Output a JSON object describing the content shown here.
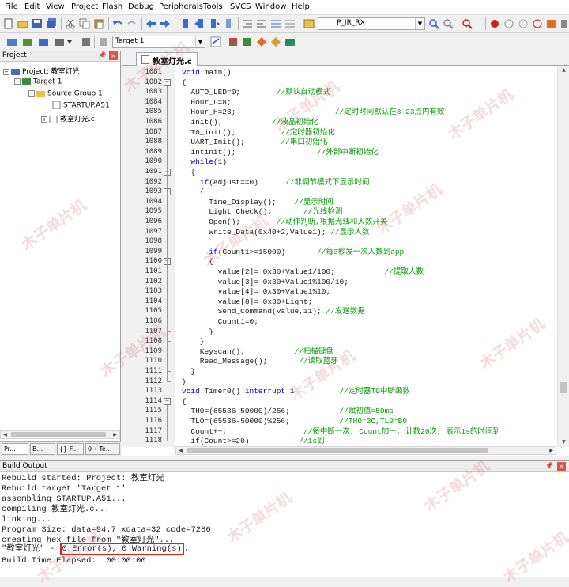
{
  "menu": [
    "File",
    "Edit",
    "View",
    "Project",
    "Flash",
    "Debug",
    "Peripherals",
    "Tools",
    "SVCS",
    "Window",
    "Help"
  ],
  "toolbar1": {
    "target_search": "P_IR_RX"
  },
  "toolbar2": {
    "target_select": "Target 1"
  },
  "project_panel": {
    "title": "Project",
    "tree": [
      {
        "label": "Project: 教室灯光",
        "icon": "project-icon"
      },
      {
        "label": "Target 1",
        "icon": "target-icon"
      },
      {
        "label": "Source Group 1",
        "icon": "folder-icon"
      },
      {
        "label": "STARTUP.A51",
        "icon": "asm-file-icon"
      },
      {
        "label": "教室灯光.c",
        "icon": "c-file-icon"
      }
    ],
    "tabs": [
      "Pr...",
      "B...",
      "{} F...",
      "0→ Te..."
    ]
  },
  "editor": {
    "tab_label": "教室灯光.c",
    "lines": [
      {
        "n": 1081,
        "code": "void main()"
      },
      {
        "n": 1082,
        "code": "{"
      },
      {
        "n": 1083,
        "code": "  AUTO_LED=0;        //默认自动模式"
      },
      {
        "n": 1084,
        "code": "  Hour_L=8;"
      },
      {
        "n": 1085,
        "code": "  Hour_H=23;                      //定时时间默认在8-23点内有效"
      },
      {
        "n": 1086,
        "code": "  init();           //液晶初始化"
      },
      {
        "n": 1087,
        "code": "  T0_init();          //定时器初始化"
      },
      {
        "n": 1088,
        "code": "  UART_Init();        //串口初始化"
      },
      {
        "n": 1089,
        "code": "  intinit();                  //外部中断初始化"
      },
      {
        "n": 1090,
        "code": "  while(1)"
      },
      {
        "n": 1091,
        "code": "  {"
      },
      {
        "n": 1092,
        "code": "    if(Adjust==0)      //非调节模式下显示时间"
      },
      {
        "n": 1093,
        "code": "    {"
      },
      {
        "n": 1094,
        "code": "      Time_Display();    //显示时间"
      },
      {
        "n": 1095,
        "code": "      Light_Check();       //光线检测"
      },
      {
        "n": 1096,
        "code": "      Open();        //动作判断,根据光线和人数开关"
      },
      {
        "n": 1097,
        "code": "      Write_Data(0x40+2,Value1); //显示人数"
      },
      {
        "n": 1098,
        "code": ""
      },
      {
        "n": 1099,
        "code": "      if(Count1>=15000)       //每3秒发一次人数到app"
      },
      {
        "n": 1100,
        "code": "      {"
      },
      {
        "n": 1101,
        "code": "        value[2]= 0x30+Value1/100;           //提取人数"
      },
      {
        "n": 1102,
        "code": "        value[3]= 0x30+Value1%100/10;"
      },
      {
        "n": 1103,
        "code": "        value[4]= 0x30+Value1%10;"
      },
      {
        "n": 1104,
        "code": "        value[8]= 0x30+Light;"
      },
      {
        "n": 1105,
        "code": "        Send_Command(value,11); //发送数据"
      },
      {
        "n": 1106,
        "code": "        Count1=0;"
      },
      {
        "n": 1107,
        "code": "      }"
      },
      {
        "n": 1108,
        "code": "    }"
      },
      {
        "n": 1109,
        "code": "    Keyscan();           //扫描键盘"
      },
      {
        "n": 1110,
        "code": "    Read_Message();       //读取蓝牙"
      },
      {
        "n": 1111,
        "code": "  }"
      },
      {
        "n": 1112,
        "code": "}"
      },
      {
        "n": 1113,
        "code": "void Timer0() interrupt 1          //定时器T0中断函数"
      },
      {
        "n": 1114,
        "code": "{"
      },
      {
        "n": 1115,
        "code": "  TH0=(65536-50000)/256;           //赋初值=50ms"
      },
      {
        "n": 1116,
        "code": "  TL0=(65536-50000)%256;           //TH0=3C,TL0=B0"
      },
      {
        "n": 1117,
        "code": "  Count++;                 //每中断一次, Count加一, 计数20次, 表示1s的时间到"
      },
      {
        "n": 1118,
        "code": "  if(Count>=20)           //1s到"
      }
    ]
  },
  "build_output": {
    "title": "Build Output",
    "lines": [
      "Rebuild started: Project: 教室灯光",
      "Rebuild target 'Target 1'",
      "assembling STARTUP.A51...",
      "compiling 教室灯光.c...",
      "linking...",
      "Program Size: data=94.7 xdata=32 code=7286",
      "creating hex file from \"教室灯光\"...",
      "\"教室灯光\" - ",
      "Build Time Elapsed:  00:00:00"
    ],
    "result_highlight": "0 Error(s), 0 Warning(s)",
    "result_suffix": "."
  },
  "watermark": "木子单片机",
  "colors": {
    "comment": "#009900",
    "keyword": "#0000c8",
    "highlight_box": "#e02020"
  }
}
